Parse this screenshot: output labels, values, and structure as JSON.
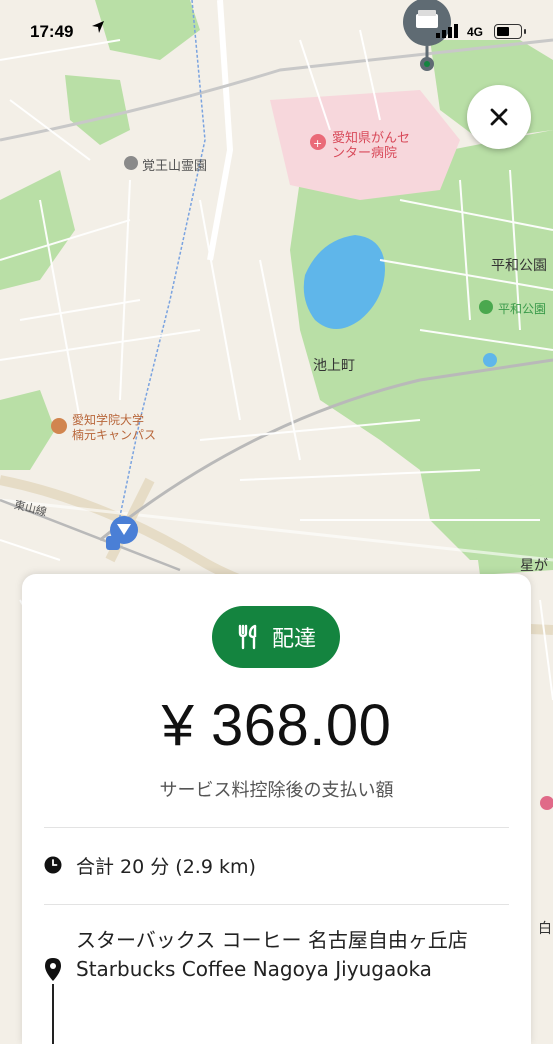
{
  "status_bar": {
    "time": "17:49",
    "network": "4G"
  },
  "map": {
    "labels": {
      "hospital": "愛知県がんセ\nンター病院",
      "cemetery": "覚王山霊園",
      "park_area": "平和公園",
      "park_poi": "平和公園",
      "town": "池上町",
      "university": "愛知学院大学\n楠元キャンパス",
      "station_line": "東山線",
      "edge_right": "星が",
      "edge_right2": "白"
    }
  },
  "order": {
    "badge_label": "配達",
    "amount": "¥ 368.00",
    "amount_caption": "サービス料控除後の支払い額",
    "duration": "合計 20 分 (2.9 km)",
    "destination": "スターバックス コーヒー 名古屋自由ヶ丘店 Starbucks Coffee Nagoya Jiyugaoka"
  },
  "colors": {
    "accent": "#14843f",
    "park": "#b9dfa6",
    "water": "#5fb6ea",
    "hospital_zone": "#f7d7dc"
  }
}
